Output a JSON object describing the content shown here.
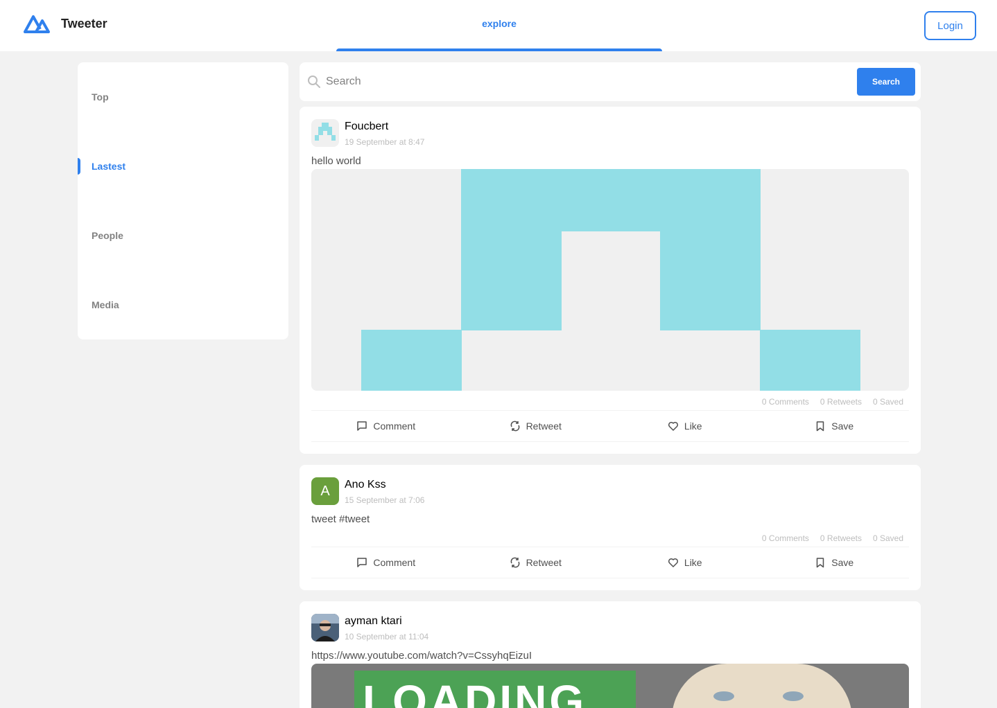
{
  "header": {
    "brand": "Tweeter",
    "nav_explore": "explore",
    "login_label": "Login",
    "accent_color": "#2f80ed"
  },
  "sidebar": {
    "items": [
      {
        "label": "Top",
        "active": false
      },
      {
        "label": "Lastest",
        "active": true
      },
      {
        "label": "People",
        "active": false
      },
      {
        "label": "Media",
        "active": false
      }
    ]
  },
  "search": {
    "placeholder": "Search",
    "button_label": "Search",
    "icon": "search-icon"
  },
  "posts": [
    {
      "author": "Foucbert",
      "date": "19 September at 8:47",
      "text": "hello world",
      "avatar": "identicon-cyan",
      "stats": {
        "comments": "0 Comments",
        "retweets": "0 Retweets",
        "saved": "0 Saved"
      },
      "actions": {
        "comment": "Comment",
        "retweet": "Retweet",
        "like": "Like",
        "save": "Save"
      }
    },
    {
      "author": "Ano Kss",
      "date": "15 September at 7:06",
      "text": "tweet #tweet",
      "avatar_letter": "A",
      "avatar_color": "#6a9f3c",
      "stats": {
        "comments": "0 Comments",
        "retweets": "0 Retweets",
        "saved": "0 Saved"
      },
      "actions": {
        "comment": "Comment",
        "retweet": "Retweet",
        "like": "Like",
        "save": "Save"
      }
    },
    {
      "author": "ayman ktari",
      "date": "10 September at 11:04",
      "text": "https://www.youtube.com/watch?v=CssyhqEizuI",
      "avatar": "photo",
      "image_caption": "LOADING"
    }
  ]
}
